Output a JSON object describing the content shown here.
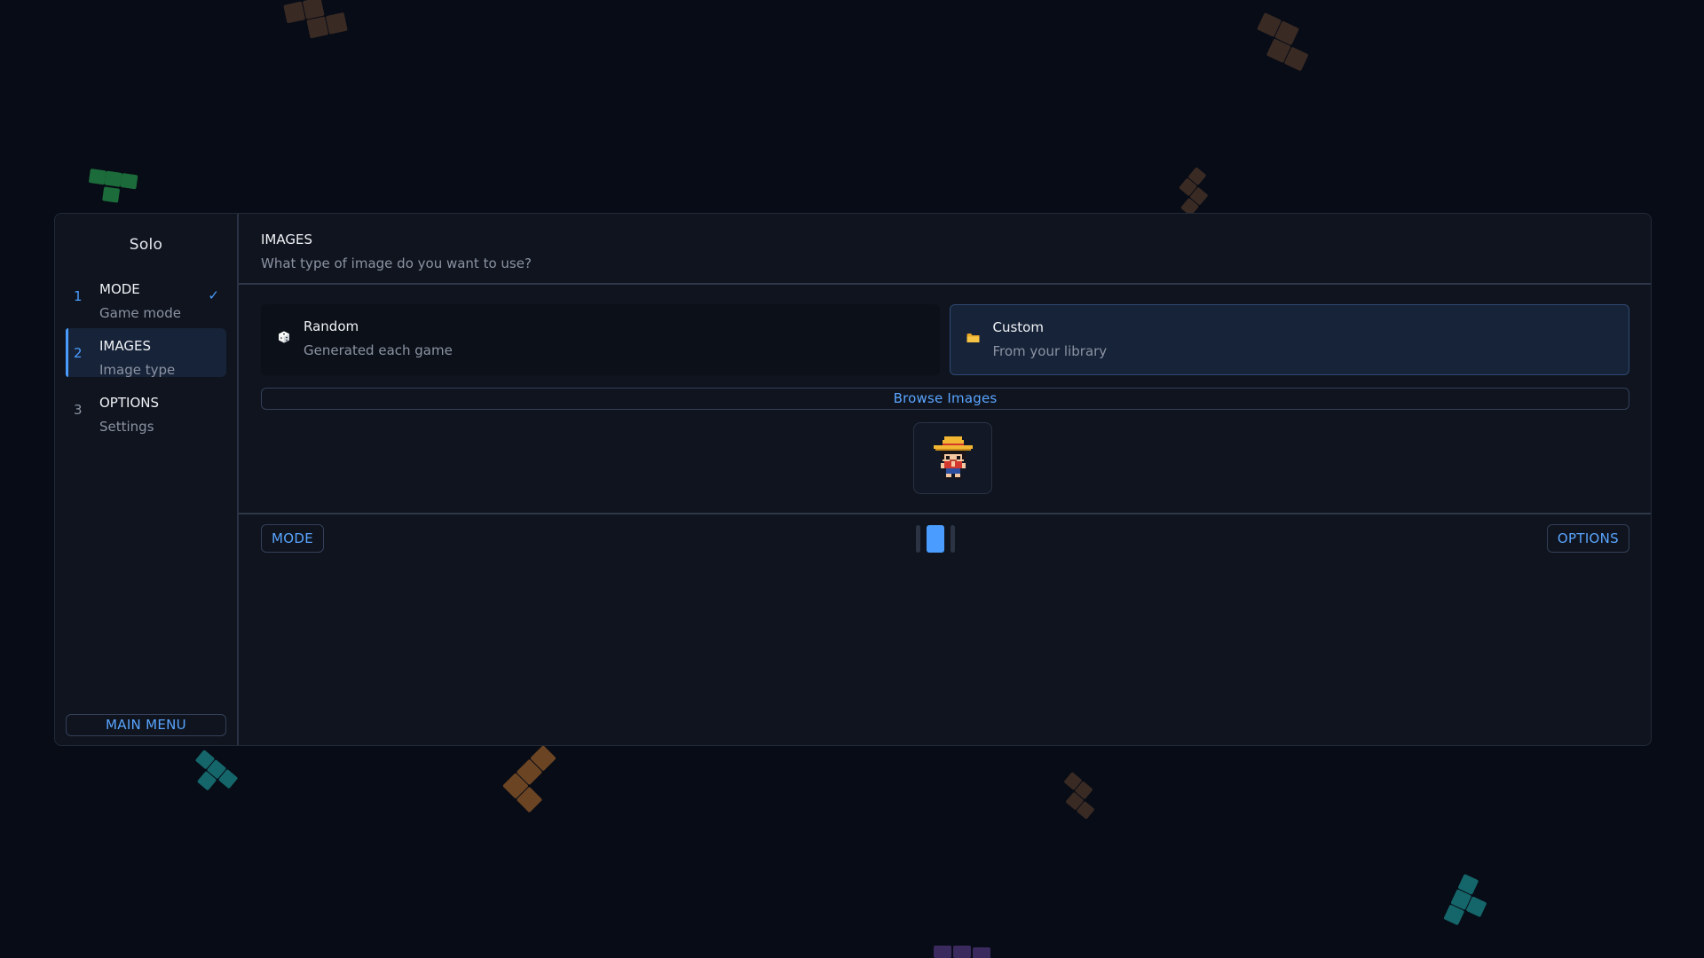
{
  "sidebar": {
    "title": "Solo",
    "steps": [
      {
        "num": "1",
        "title": "MODE",
        "sub": "Game mode",
        "state": "done",
        "check": "✓"
      },
      {
        "num": "2",
        "title": "IMAGES",
        "sub": "Image type",
        "state": "active"
      },
      {
        "num": "3",
        "title": "OPTIONS",
        "sub": "Settings",
        "state": "pending"
      }
    ],
    "main_menu_label": "MAIN MENU"
  },
  "header": {
    "title": "IMAGES",
    "subtitle": "What type of image do you want to use?"
  },
  "choices": [
    {
      "title": "Random",
      "sub": "Generated each game",
      "icon": "dice-icon",
      "selected": false
    },
    {
      "title": "Custom",
      "sub": "From your library",
      "icon": "folder-icon",
      "selected": true
    }
  ],
  "browse_label": "Browse Images",
  "thumbnail": {
    "icon": "pixel-character-straw-hat"
  },
  "footer": {
    "prev_label": "MODE",
    "next_label": "OPTIONS",
    "step_indicator": {
      "total": 3,
      "current": 2
    }
  },
  "colors": {
    "background": "#070c16",
    "panel": "#0f141e",
    "accent": "#4a9dff",
    "selected_card": "#172338"
  }
}
